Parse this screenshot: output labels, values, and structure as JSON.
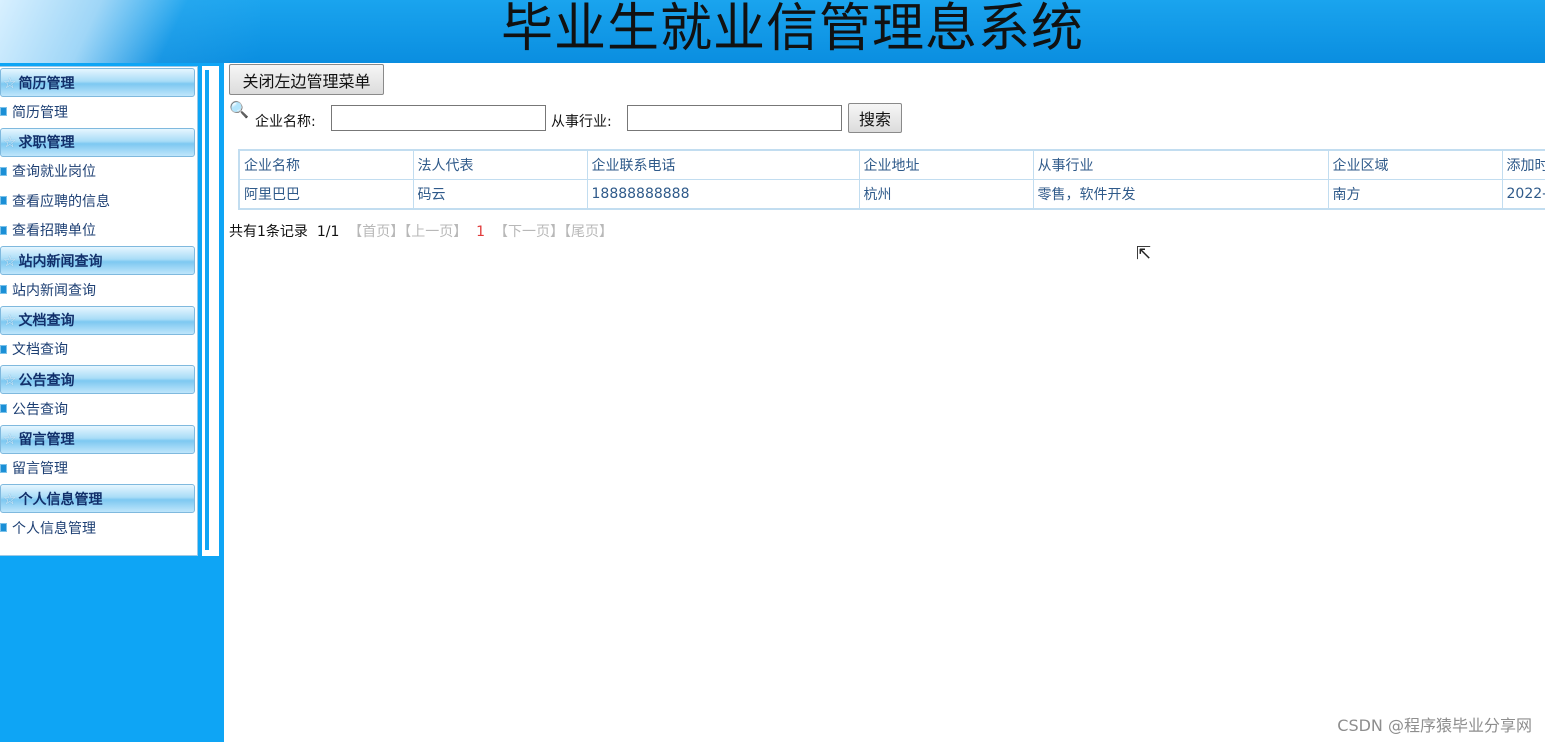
{
  "header": {
    "title": "毕业生就业信管理息系统"
  },
  "sidebar": {
    "groups": [
      {
        "title": "简历管理",
        "items": [
          "简历管理"
        ]
      },
      {
        "title": "求职管理",
        "items": [
          "查询就业岗位",
          "查看应聘的信息",
          "查看招聘单位"
        ]
      },
      {
        "title": "站内新闻查询",
        "items": [
          "站内新闻查询"
        ]
      },
      {
        "title": "文档查询",
        "items": [
          "文档查询"
        ]
      },
      {
        "title": "公告查询",
        "items": [
          "公告查询"
        ]
      },
      {
        "title": "留言管理",
        "items": [
          "留言管理"
        ]
      },
      {
        "title": "个人信息管理",
        "items": [
          "个人信息管理"
        ]
      }
    ]
  },
  "toolbar": {
    "close_menu_label": "关闭左边管理菜单"
  },
  "search": {
    "company_label": "企业名称:",
    "company_value": "",
    "industry_label": "从事行业:",
    "industry_value": "",
    "search_label": "搜索"
  },
  "table": {
    "columns": [
      "企业名称",
      "法人代表",
      "企业联系电话",
      "企业地址",
      "从事行业",
      "企业区域",
      "添加时"
    ],
    "rows": [
      [
        "阿里巴巴",
        "码云",
        "18888888888",
        "杭州",
        "零售，软件开发",
        "南方",
        "2022-"
      ]
    ]
  },
  "pager": {
    "summary": "共有1条记录",
    "page": "1/1",
    "first": "【首页】",
    "prev": "【上一页】",
    "current": "1",
    "next": "【下一页】",
    "last": "【尾页】"
  },
  "watermark": "CSDN @程序猿毕业分享网",
  "icons": {
    "group": "star-icon",
    "item": "square-bullet-icon",
    "search": "magnifier-icon"
  }
}
